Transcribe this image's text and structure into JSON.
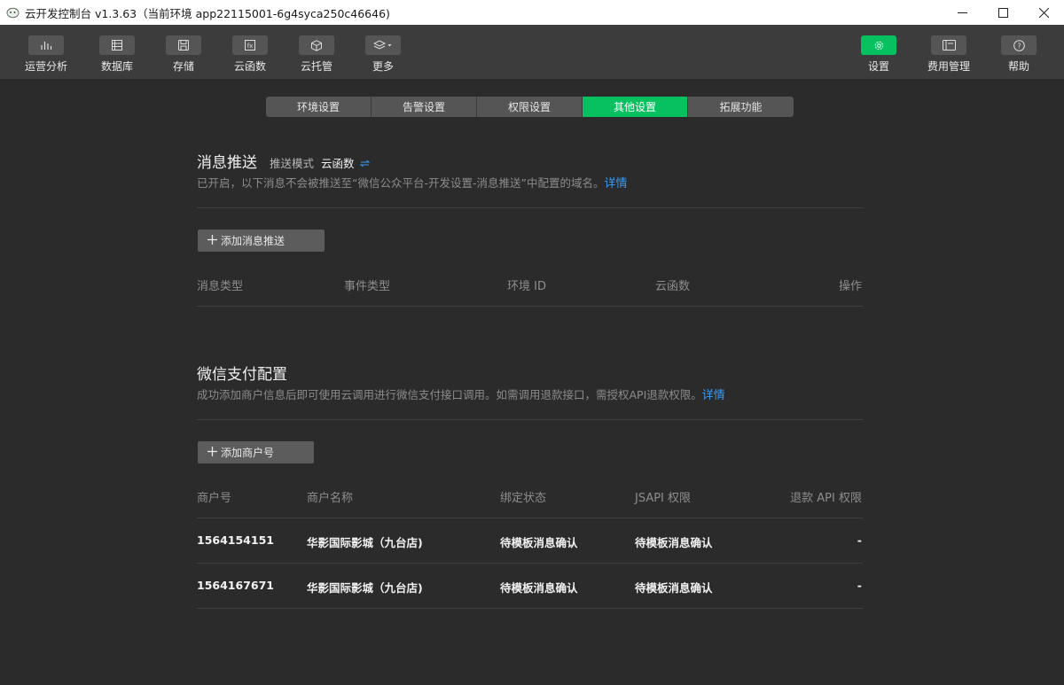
{
  "window": {
    "title": "云开发控制台 v1.3.63（当前环境 app22115001-6g4syca250c46646)"
  },
  "toolbar": {
    "left": [
      {
        "label": "运营分析",
        "icon": "bar-chart-icon"
      },
      {
        "label": "数据库",
        "icon": "database-icon"
      },
      {
        "label": "存储",
        "icon": "storage-icon"
      },
      {
        "label": "云函数",
        "icon": "function-icon"
      },
      {
        "label": "云托管",
        "icon": "cube-icon"
      },
      {
        "label": "更多",
        "icon": "layers-icon"
      }
    ],
    "right": [
      {
        "label": "设置",
        "icon": "gear-icon"
      },
      {
        "label": "费用管理",
        "icon": "billing-icon"
      },
      {
        "label": "帮助",
        "icon": "help-icon"
      }
    ]
  },
  "tabs": [
    "环境设置",
    "告警设置",
    "权限设置",
    "其他设置",
    "拓展功能"
  ],
  "active_tab": "其他设置",
  "push": {
    "title": "消息推送",
    "mode_label": "推送模式",
    "mode_value": "云函数",
    "desc": "已开启，以下消息不会被推送至“微信公众平台-开发设置-消息推送”中配置的域名。",
    "detail_link": "详情",
    "add_button": "添加消息推送",
    "columns": [
      "消息类型",
      "事件类型",
      "环境 ID",
      "云函数",
      "操作"
    ]
  },
  "pay": {
    "title": "微信支付配置",
    "desc": "成功添加商户信息后即可使用云调用进行微信支付接口调用。如需调用退款接口，需授权API退款权限。",
    "detail_link": "详情",
    "add_button": "添加商户号",
    "columns": [
      "商户号",
      "商户名称",
      "绑定状态",
      "JSAPI 权限",
      "退款 API 权限"
    ],
    "rows": [
      [
        "1564154151",
        "华影国际影城（九台店)",
        "待模板消息确认",
        "待模板消息确认",
        "-"
      ],
      [
        "1564167671",
        "华影国际影城（九台店)",
        "待模板消息确认",
        "待模板消息确认",
        "-"
      ]
    ]
  },
  "colors": {
    "accent": "#07c160",
    "link": "#3a9bf4",
    "background": "#2b2b2b",
    "toolbar": "#3c3c3c"
  }
}
